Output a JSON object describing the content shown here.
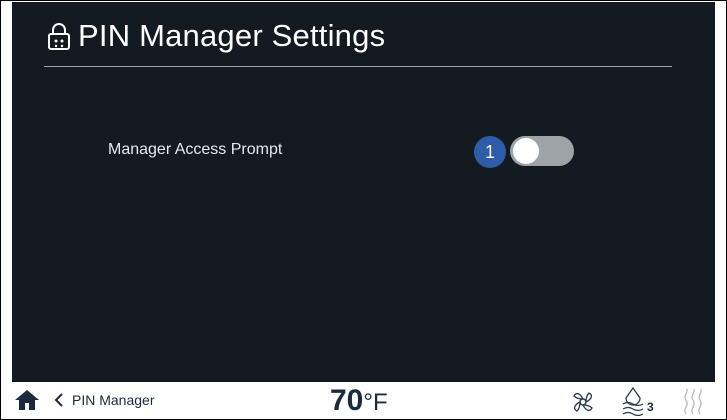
{
  "header": {
    "title": "PIN Manager Settings",
    "icon": "lock-icon"
  },
  "settings": {
    "manager_access_prompt": {
      "label": "Manager Access Prompt",
      "state": "off"
    }
  },
  "annotation": {
    "badge_number": "1"
  },
  "bottom_bar": {
    "back_label": "PIN Manager",
    "temperature_value": "70",
    "temperature_unit": "°F",
    "water_level": "3"
  },
  "colors": {
    "screen_background": "#141a22",
    "toggle_off_track": "#9ea3a8",
    "badge_blue": "#2e5ca8",
    "bottom_text": "#1c2a3c"
  }
}
